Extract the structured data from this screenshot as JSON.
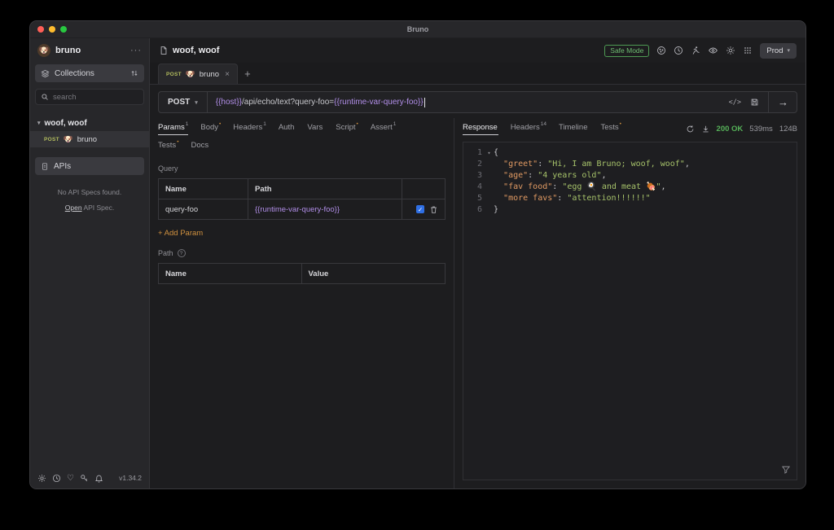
{
  "window": {
    "title": "Bruno"
  },
  "sidebar": {
    "workspace": {
      "avatar": "🐶",
      "name": "bruno",
      "menu": "···"
    },
    "collections": {
      "label": "Collections"
    },
    "search": {
      "placeholder": "search"
    },
    "collection": {
      "name": "woof, woof"
    },
    "request_item": {
      "method": "POST",
      "emoji": "🐶",
      "name": "bruno"
    },
    "apis": {
      "label": "APIs",
      "empty_text": "No API Specs found.",
      "open_link": "Open",
      "open_suffix": " API Spec."
    },
    "version": "v1.34.2"
  },
  "header": {
    "title": "woof, woof",
    "safe_mode": "Safe Mode",
    "environment": "Prod"
  },
  "tabbar": {
    "tab": {
      "method": "POST",
      "emoji": "🐶",
      "name": "bruno",
      "close": "×"
    },
    "new_tab": "+"
  },
  "urlbar": {
    "method": "POST",
    "segments": [
      {
        "text": "{{host}}",
        "kind": "var"
      },
      {
        "text": "/api/echo/text?query-foo=",
        "kind": "plain"
      },
      {
        "text": "{{runtime-var-query-foo}}",
        "kind": "var"
      }
    ],
    "code_icon": "</>"
  },
  "request_panel": {
    "tabs_row1": [
      {
        "label": "Params",
        "sup": "1"
      },
      {
        "label": "Body",
        "sup": "•"
      },
      {
        "label": "Headers",
        "sup": "1"
      },
      {
        "label": "Auth",
        "sup": ""
      },
      {
        "label": "Vars",
        "sup": ""
      },
      {
        "label": "Script",
        "sup": "•"
      },
      {
        "label": "Assert",
        "sup": "1"
      }
    ],
    "tabs_row2": [
      {
        "label": "Tests",
        "sup": "•"
      },
      {
        "label": "Docs",
        "sup": ""
      }
    ],
    "query": {
      "section_label": "Query",
      "columns": [
        "Name",
        "Path"
      ],
      "rows": [
        {
          "name": "query-foo",
          "path": "{{runtime-var-query-foo}}",
          "enabled": "✓"
        }
      ],
      "add_label": "+ Add Param"
    },
    "path": {
      "section_label": "Path",
      "columns": [
        "Name",
        "Value"
      ]
    }
  },
  "response_panel": {
    "tabs": [
      {
        "label": "Response",
        "sup": ""
      },
      {
        "label": "Headers",
        "sup": "14"
      },
      {
        "label": "Timeline",
        "sup": ""
      },
      {
        "label": "Tests",
        "sup": "•"
      }
    ],
    "status": {
      "code": "200 OK",
      "duration": "539ms",
      "size": "124B"
    },
    "code_lines": [
      {
        "num": "1",
        "fold": "▾",
        "segs": [
          {
            "t": "{",
            "c": "punct"
          }
        ]
      },
      {
        "num": "2",
        "fold": "",
        "segs": [
          {
            "t": "  ",
            "c": "punct"
          },
          {
            "t": "\"greet\"",
            "c": "key"
          },
          {
            "t": ": ",
            "c": "punct"
          },
          {
            "t": "\"Hi, I am Bruno; woof, woof\"",
            "c": "str"
          },
          {
            "t": ",",
            "c": "punct"
          }
        ]
      },
      {
        "num": "3",
        "fold": "",
        "segs": [
          {
            "t": "  ",
            "c": "punct"
          },
          {
            "t": "\"age\"",
            "c": "key"
          },
          {
            "t": ": ",
            "c": "punct"
          },
          {
            "t": "\"4 years old\"",
            "c": "str"
          },
          {
            "t": ",",
            "c": "punct"
          }
        ]
      },
      {
        "num": "4",
        "fold": "",
        "segs": [
          {
            "t": "  ",
            "c": "punct"
          },
          {
            "t": "\"fav food\"",
            "c": "key"
          },
          {
            "t": ": ",
            "c": "punct"
          },
          {
            "t": "\"egg 🍳 and meat 🍖\"",
            "c": "str"
          },
          {
            "t": ",",
            "c": "punct"
          }
        ]
      },
      {
        "num": "5",
        "fold": "",
        "segs": [
          {
            "t": "  ",
            "c": "punct"
          },
          {
            "t": "\"more favs\"",
            "c": "key"
          },
          {
            "t": ": ",
            "c": "punct"
          },
          {
            "t": "\"attention!!!!!!\"",
            "c": "str"
          }
        ]
      },
      {
        "num": "6",
        "fold": "",
        "segs": [
          {
            "t": "}",
            "c": "punct"
          }
        ]
      }
    ]
  }
}
